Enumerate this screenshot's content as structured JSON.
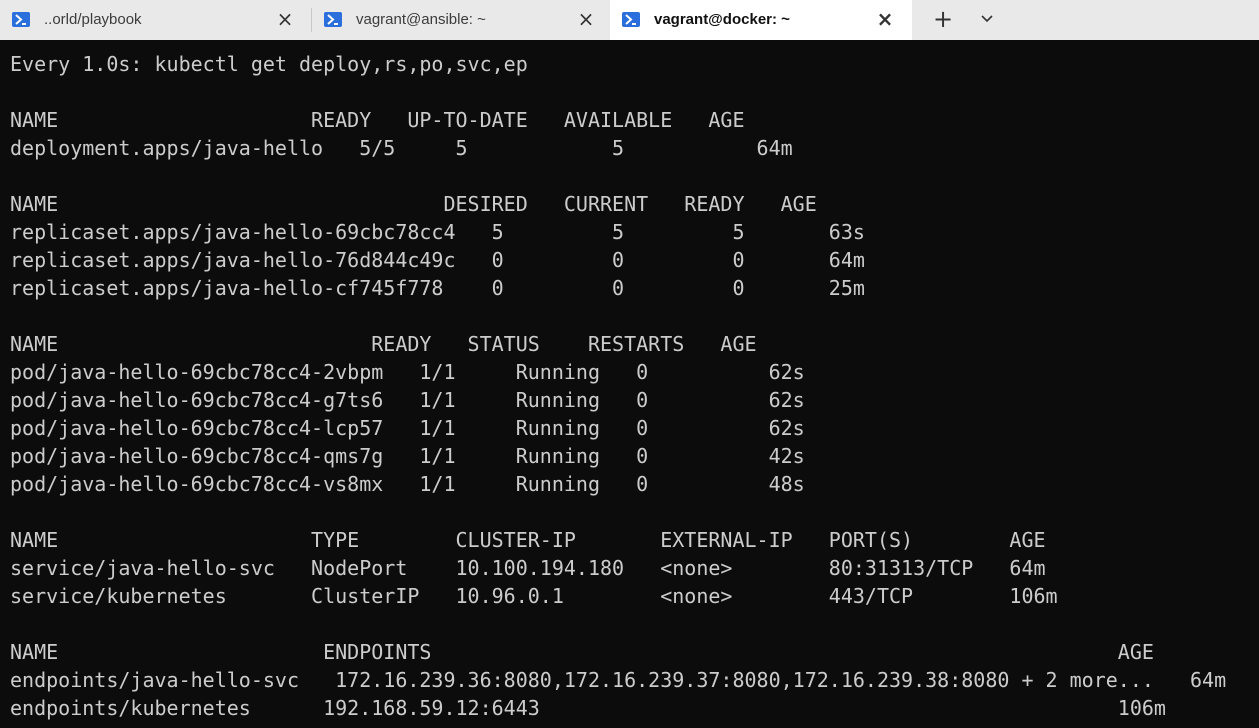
{
  "tabs": [
    {
      "title": "..orld/playbook",
      "active": false
    },
    {
      "title": "vagrant@ansible: ~",
      "active": false
    },
    {
      "title": "vagrant@docker: ~",
      "active": true
    }
  ],
  "tabbar": {
    "new_tab": "+",
    "dropdown": "⌄",
    "close_symbol": "×"
  },
  "terminal": {
    "lines": [
      "Every 1.0s: kubectl get deploy,rs,po,svc,ep",
      "",
      "NAME                     READY   UP-TO-DATE   AVAILABLE   AGE",
      "deployment.apps/java-hello   5/5     5            5           64m",
      "",
      "NAME                                DESIRED   CURRENT   READY   AGE",
      "replicaset.apps/java-hello-69cbc78cc4   5         5         5       63s",
      "replicaset.apps/java-hello-76d844c49c   0         0         0       64m",
      "replicaset.apps/java-hello-cf745f778    0         0         0       25m",
      "",
      "NAME                          READY   STATUS    RESTARTS   AGE",
      "pod/java-hello-69cbc78cc4-2vbpm   1/1     Running   0          62s",
      "pod/java-hello-69cbc78cc4-g7ts6   1/1     Running   0          62s",
      "pod/java-hello-69cbc78cc4-lcp57   1/1     Running   0          62s",
      "pod/java-hello-69cbc78cc4-qms7g   1/1     Running   0          42s",
      "pod/java-hello-69cbc78cc4-vs8mx   1/1     Running   0          48s",
      "",
      "NAME                     TYPE        CLUSTER-IP       EXTERNAL-IP   PORT(S)        AGE",
      "service/java-hello-svc   NodePort    10.100.194.180   <none>        80:31313/TCP   64m",
      "service/kubernetes       ClusterIP   10.96.0.1        <none>        443/TCP        106m",
      "",
      "NAME                      ENDPOINTS                                                         AGE",
      "endpoints/java-hello-svc   172.16.239.36:8080,172.16.239.37:8080,172.16.239.38:8080 + 2 more...   64m",
      "endpoints/kubernetes      192.168.59.12:6443                                                106m"
    ]
  },
  "colors": {
    "terminal_bg": "#0c0c0c",
    "terminal_fg": "#cccccc",
    "tab_accent": "#2a6fdb"
  }
}
